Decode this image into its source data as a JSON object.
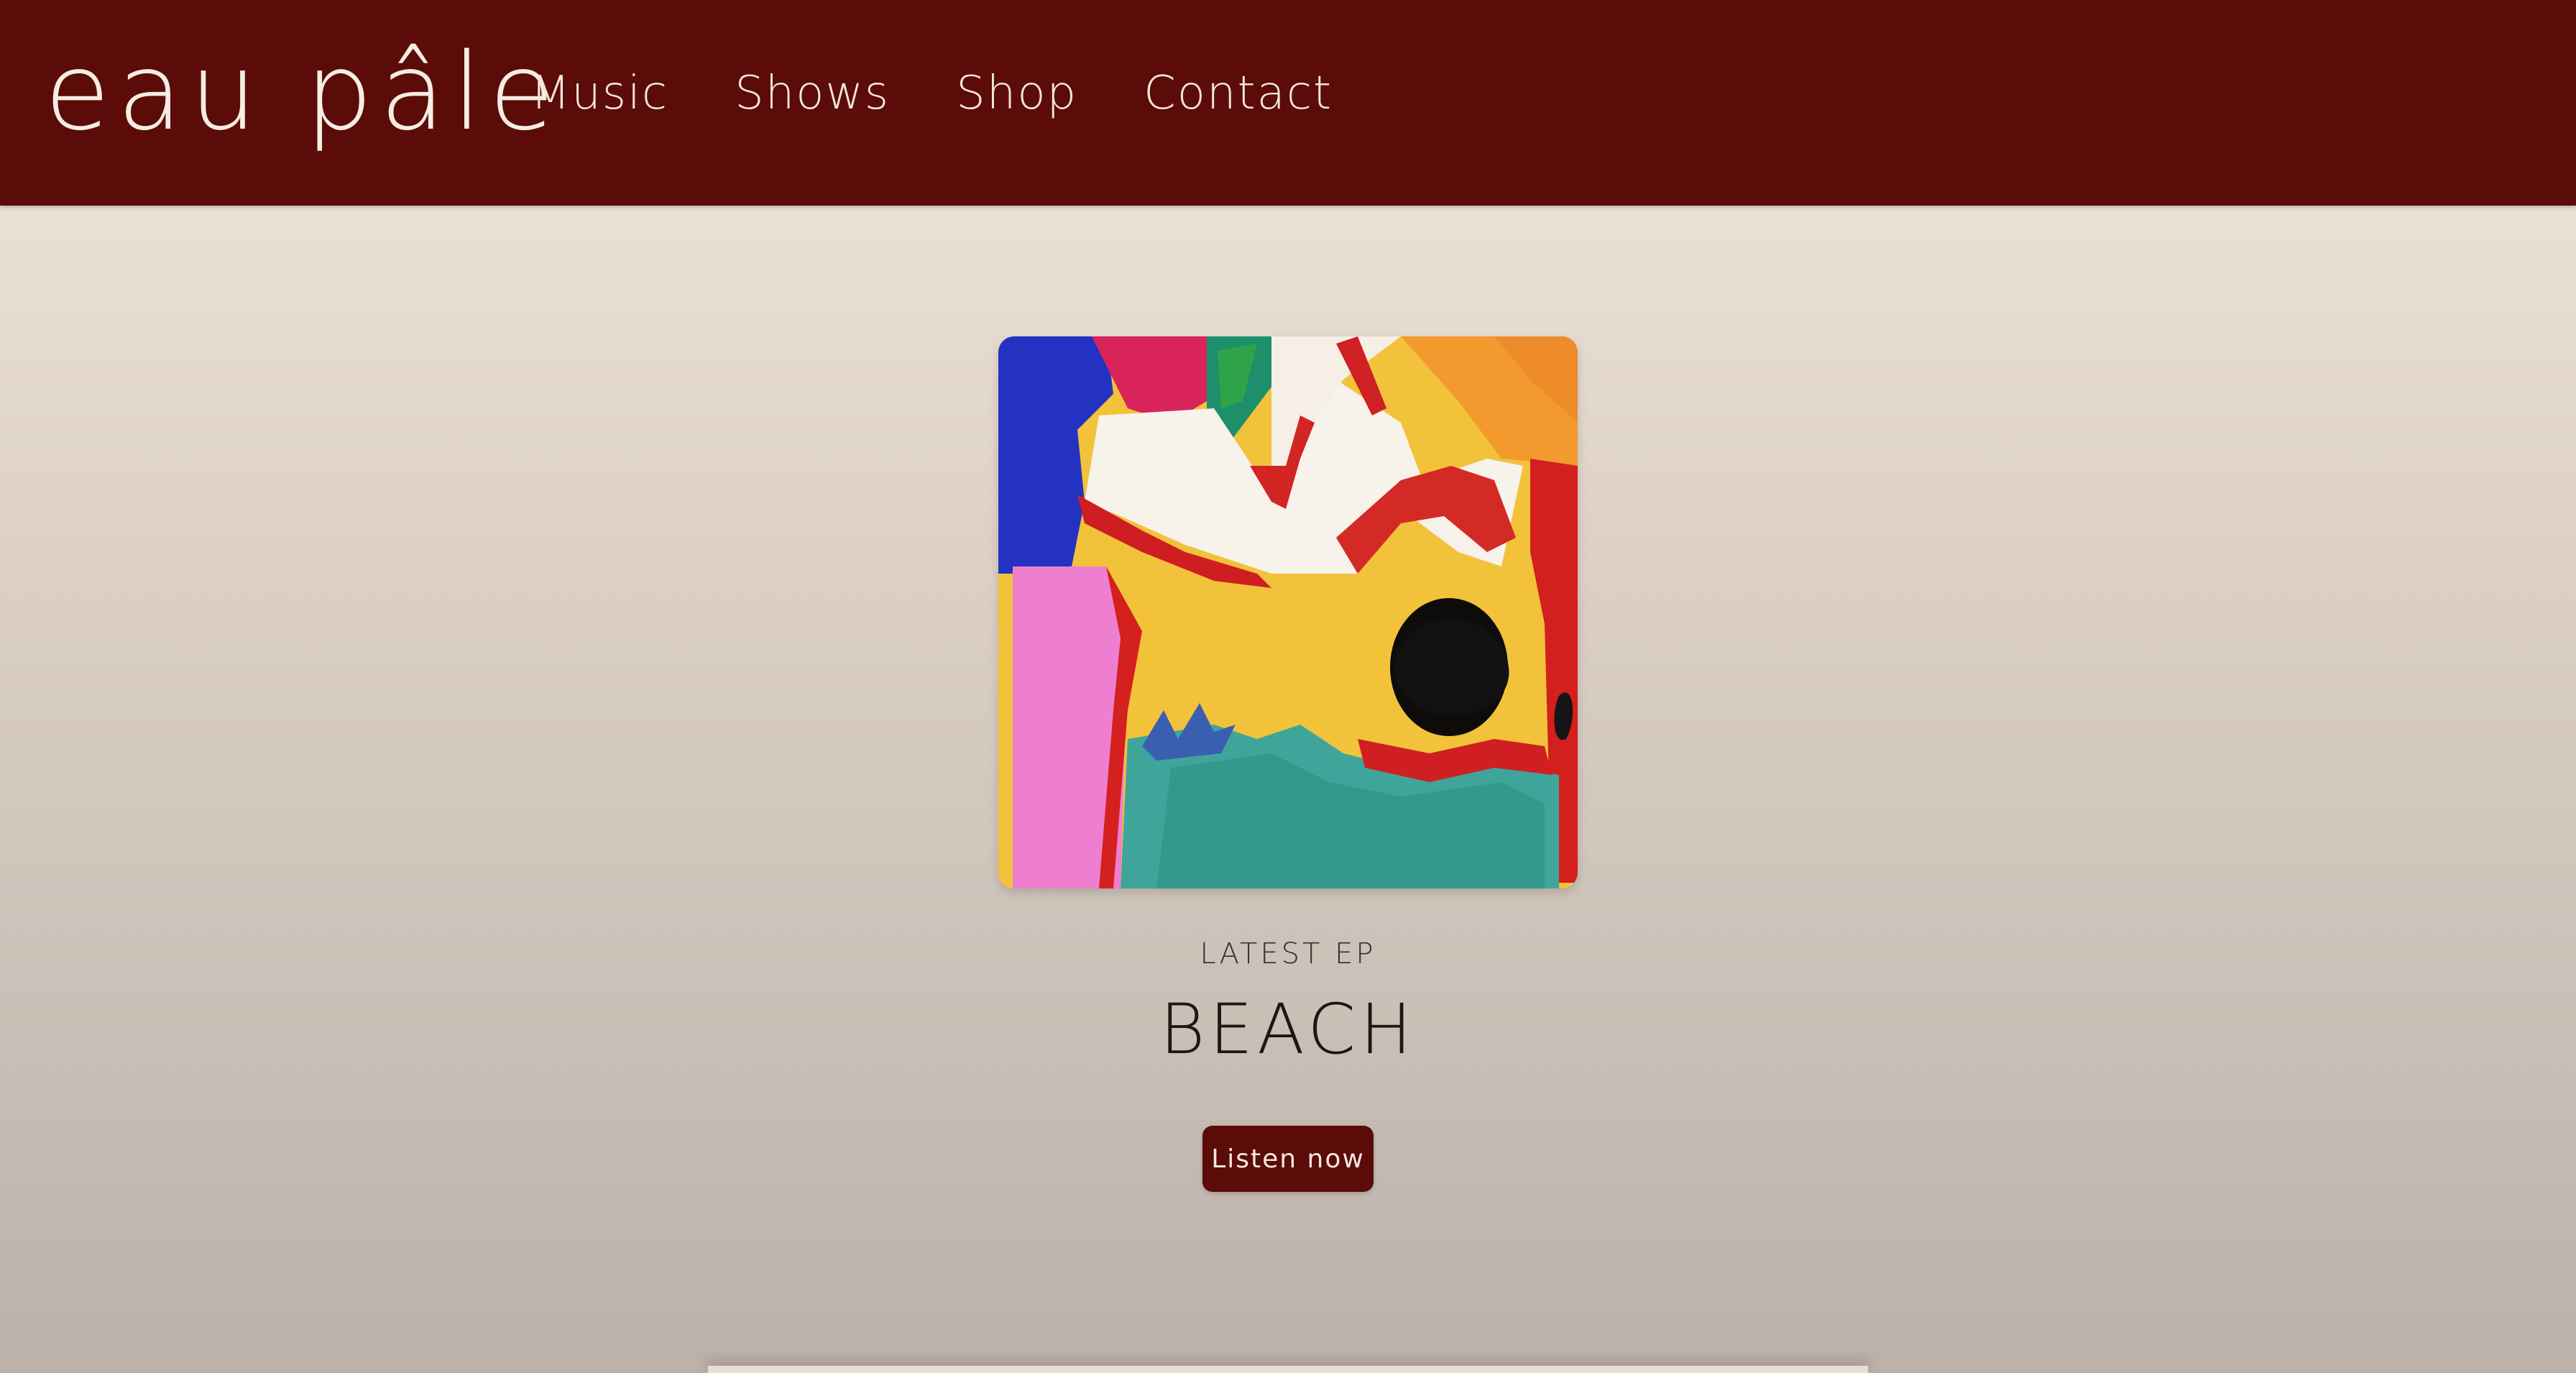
{
  "brand": {
    "name": "eau pâle",
    "primary_color": "#5b0c08",
    "text_light": "#f6ece4"
  },
  "nav": {
    "items": [
      {
        "label": "Music"
      },
      {
        "label": "Shows"
      },
      {
        "label": "Shop"
      },
      {
        "label": "Contact"
      }
    ]
  },
  "hero": {
    "artwork_icon": "album-cover-abstract-painting",
    "eyebrow": "LATEST EP",
    "title": "BEACH",
    "cta_label": "Listen now"
  }
}
